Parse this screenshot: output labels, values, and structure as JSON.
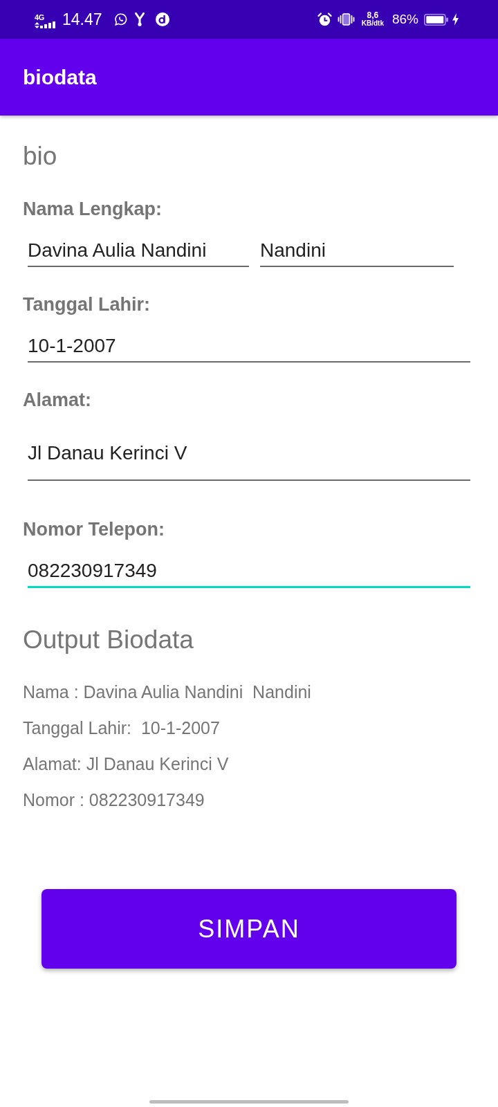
{
  "status_bar": {
    "network_type": "4G",
    "time": "14.47",
    "network_speed": "8,6",
    "network_speed_unit": "KB/dtk",
    "battery_percent": "86%"
  },
  "app_bar": {
    "title": "biodata"
  },
  "form": {
    "title": "bio",
    "groups": [
      {
        "label": "Nama Lengkap:",
        "fields": [
          {
            "kind": "single",
            "value": "Davina Aulia Nandini",
            "focused": false
          },
          {
            "kind": "single",
            "value": "Nandini",
            "focused": false
          }
        ]
      },
      {
        "label": "Tanggal Lahir:",
        "fields": [
          {
            "kind": "single",
            "value": "10-1-2007",
            "focused": false
          }
        ]
      },
      {
        "label": "Alamat:",
        "fields": [
          {
            "kind": "multiline",
            "value": "Jl Danau Kerinci V",
            "focused": false
          }
        ]
      },
      {
        "label": "Nomor Telepon:",
        "fields": [
          {
            "kind": "single",
            "value": "082230917349",
            "focused": true
          }
        ]
      }
    ]
  },
  "output": {
    "title": "Output Biodata",
    "lines": [
      "Nama : Davina Aulia Nandini  Nandini",
      "Tanggal Lahir:  10-1-2007",
      "Alamat: Jl Danau Kerinci V",
      "Nomor : 082230917349"
    ]
  },
  "button": {
    "label": "SIMPAN"
  }
}
